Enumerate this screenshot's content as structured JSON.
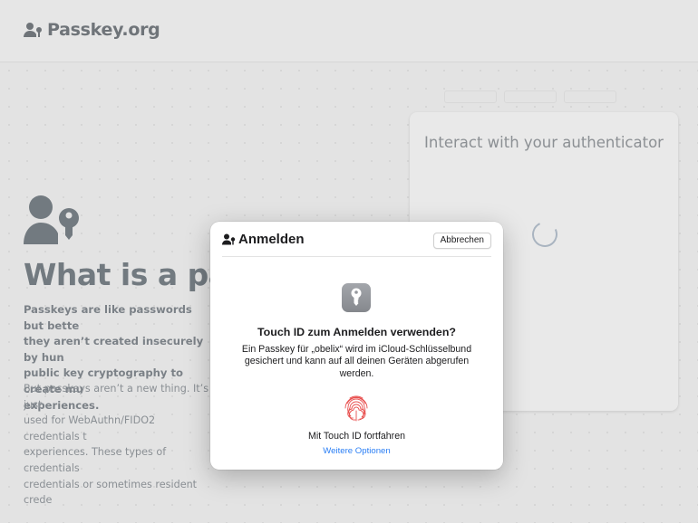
{
  "site": {
    "logo_text": "Passkey.org"
  },
  "hero": {
    "title": "What is a pas",
    "paragraph1": "Passkeys are like passwords but bette\nthey aren’t created insecurely by hun\npublic key cryptography to create mu\nexperiences.",
    "paragraph2": "But passkeys aren’t a new thing. It’s just\nused for WebAuthn/FIDO2 credentials t\nexperiences. These types of credentials\ncredentials or sometimes resident crede"
  },
  "auth_panel": {
    "title": "Interact with your authenticator"
  },
  "dialog": {
    "title": "Anmelden",
    "cancel_label": "Abbrechen",
    "prompt": "Touch ID zum Anmelden verwenden?",
    "description": "Ein Passkey für „obelix“ wird im iCloud-Schlüsselbund gesichert und kann auf all deinen Geräten abgerufen werden.",
    "continue_label": "Mit Touch ID fortfahren",
    "more_options_label": "Weitere Optionen"
  },
  "icons": {
    "logo": "user-key-icon",
    "hero": "user-key-icon",
    "dialog_title": "user-key-icon",
    "app": "key-icon",
    "biometric": "fingerprint-icon"
  },
  "colors": {
    "link": "#2b7ff5",
    "fingerprint": "#e8504f",
    "overlay_bg": "#e3e3e3"
  }
}
